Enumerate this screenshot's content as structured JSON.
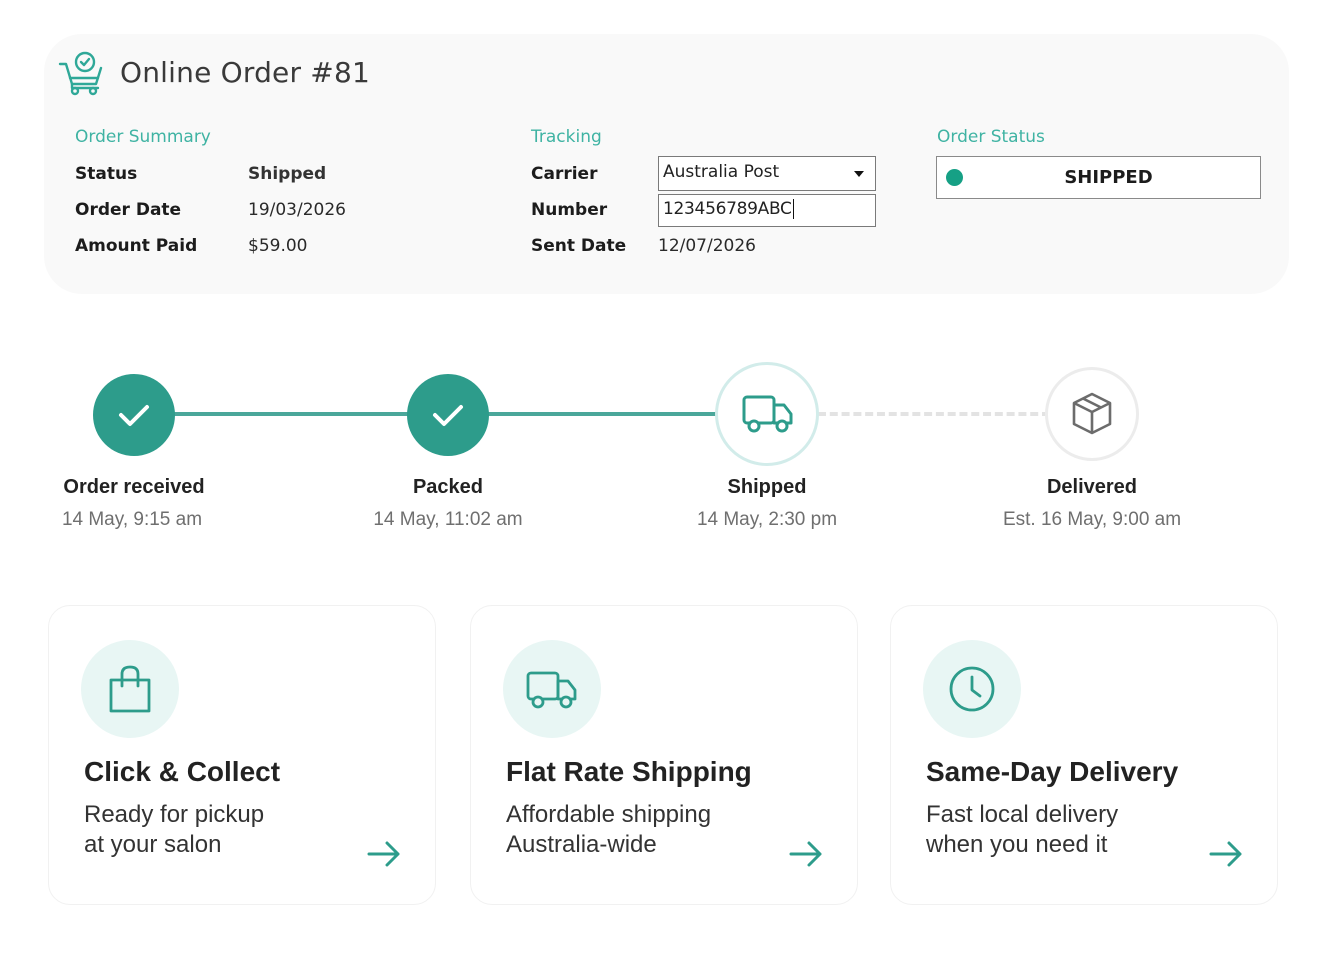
{
  "header": {
    "title": "Online Order #81",
    "icon": "cart-check-icon"
  },
  "order_summary": {
    "section_title": "Order Summary",
    "rows": [
      {
        "label": "Status",
        "value": "Shipped"
      },
      {
        "label": "Order Date",
        "value": "19/03/2026"
      },
      {
        "label": "Amount Paid",
        "value": "$59.00"
      }
    ]
  },
  "tracking": {
    "section_title": "Tracking",
    "carrier_label": "Carrier",
    "carrier_value": "Australia Post",
    "number_label": "Number",
    "number_value": "123456789ABC",
    "sent_label": "Sent Date",
    "sent_value": "12/07/2026"
  },
  "order_status": {
    "section_title": "Order Status",
    "value": "SHIPPED",
    "dot_color": "#16a085"
  },
  "progress": {
    "accent": "#2d9c8b",
    "steps": [
      {
        "label": "Order received",
        "time": "14 May, 9:15 am",
        "state": "done",
        "icon": "check-icon"
      },
      {
        "label": "Packed",
        "time": "14 May, 11:02 am",
        "state": "done",
        "icon": "check-icon"
      },
      {
        "label": "Shipped",
        "time": "14 May, 2:30 pm",
        "state": "current",
        "icon": "truck-icon"
      },
      {
        "label": "Delivered",
        "time": "Est. 16 May, 9:00 am",
        "state": "pending",
        "icon": "box-icon"
      }
    ]
  },
  "cards": [
    {
      "title": "Click & Collect",
      "line1": "Ready for pickup",
      "line2": "at your salon",
      "icon": "shopping-bag-icon"
    },
    {
      "title": "Flat Rate Shipping",
      "line1": "Affordable shipping",
      "line2": "Australia-wide",
      "icon": "truck-icon"
    },
    {
      "title": "Same-Day Delivery",
      "line1": "Fast local delivery",
      "line2": "when you need it",
      "icon": "clock-icon"
    }
  ]
}
